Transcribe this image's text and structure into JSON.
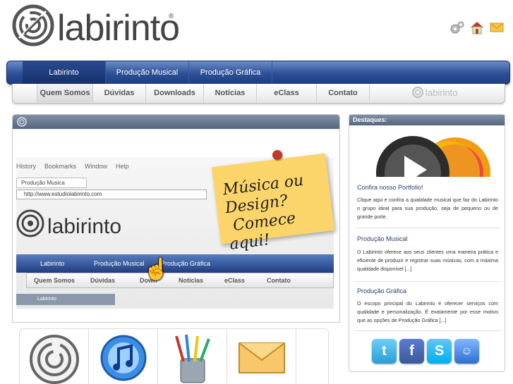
{
  "brand": {
    "name": "labirinto",
    "reg": "®"
  },
  "top_icons": [
    "settings-icon",
    "home-icon",
    "mail-icon"
  ],
  "main_nav": [
    {
      "label": "Labirinto",
      "active": true
    },
    {
      "label": "Produção Musical",
      "active": false
    },
    {
      "label": "Produção Gráfica",
      "active": false
    }
  ],
  "sub_nav": [
    {
      "label": "Quem Somos",
      "active": true
    },
    {
      "label": "Dúvidas",
      "active": false
    },
    {
      "label": "Downloads",
      "active": false
    },
    {
      "label": "Notícias",
      "active": false
    },
    {
      "label": "eClass",
      "active": false
    },
    {
      "label": "Contato",
      "active": false
    }
  ],
  "subnav_logo": "labirinto",
  "feature": {
    "screenshot": {
      "menu": [
        "History",
        "Bookmarks",
        "Window",
        "Help"
      ],
      "tab": "Produção Musica",
      "url": "http://www.estudiolabirinto.com",
      "word": "labirinto",
      "nav": [
        "Labirinto",
        "Produção Musical",
        "Produção Gráfica"
      ],
      "subnav": [
        "Quem Somos",
        "Dúvidas",
        "Down",
        "Notícias",
        "eClass",
        "Contato"
      ],
      "strip": "Labirinto"
    },
    "note_line1": "Música ou Design?",
    "note_line2": "Comece aqui!"
  },
  "tiles": [
    "labyrinth-icon",
    "itunes-music-icon",
    "brushes-icon",
    "envelope-icon"
  ],
  "sidebar": {
    "title": "Destaques:",
    "portfolio_heading": "Confira nosso Portfolio!",
    "portfolio_text": "Clique aqui e confira a qualidade musical que faz do Labirinto o grupo ideal para sua produção, seja de pequeno ou de grande porte.",
    "music_heading": "Produção Musical",
    "music_text": "O Labirinto oferece aos seus clientes uma maneira prática e eficiente de produzir e registrar suas músicas, com a máxima qualidade disponível [...]",
    "graphic_heading": "Produção Gráfica",
    "graphic_text": "O escopo principal do Labirinto é oferecer serviços com qualidade e personalização. É exatamente por esse motivo que as opções de Produção Gráfica [...]",
    "social": [
      "twitter-icon",
      "facebook-icon",
      "skype-icon",
      "messenger-icon"
    ]
  },
  "colors": {
    "nav_blue": "#2d4f96",
    "heading_blue": "#2d3d6a",
    "note_yellow": "#fbd56a"
  }
}
